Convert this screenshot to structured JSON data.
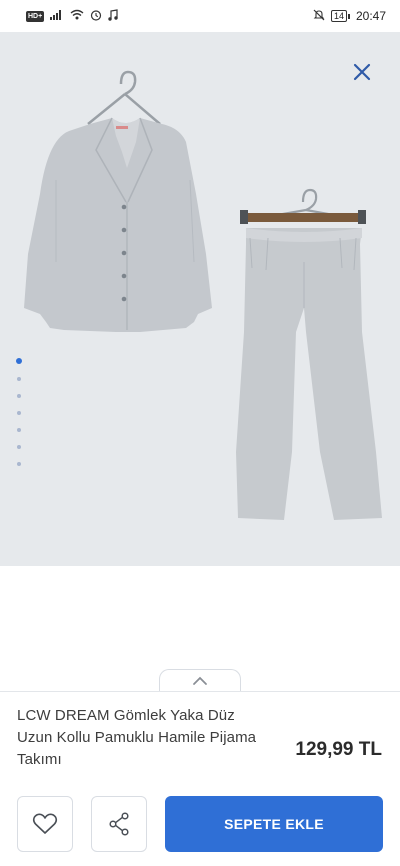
{
  "status_bar": {
    "left_badge": "HD+",
    "battery": "14",
    "time": "20:47"
  },
  "gallery": {
    "current_index": 1,
    "image_count": 7,
    "background_color": "#e6e9ec",
    "close_icon": "close-icon"
  },
  "product": {
    "title": "LCW DREAM Gömlek Yaka Düz Uzun Kollu Pamuklu Hamile Pijama Takımı",
    "price": "129,99 TL"
  },
  "actions": {
    "favorite_icon": "heart-icon",
    "share_icon": "share-icon",
    "add_to_cart_label": "SEPETE EKLE"
  },
  "colors": {
    "accent": "#2f6fd6",
    "text": "#3d3d3d"
  }
}
